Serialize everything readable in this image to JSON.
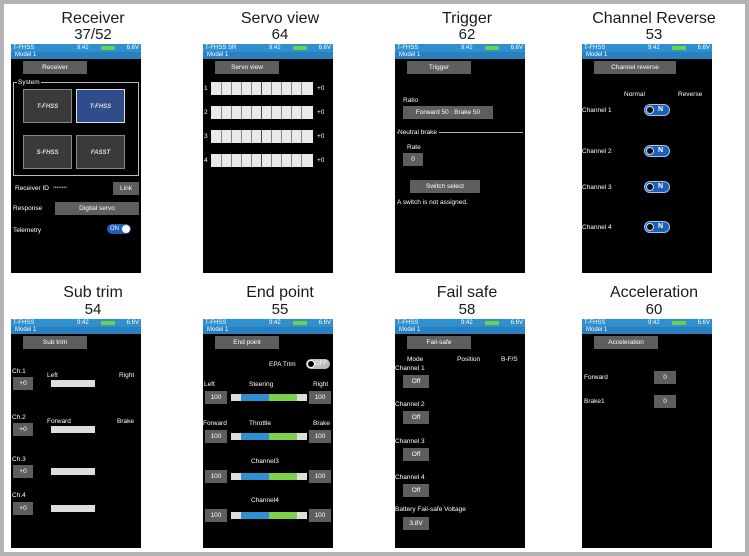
{
  "common": {
    "status_left": "T-FHSS",
    "time": "9:42",
    "volt": "6.6V",
    "model": "Model 1"
  },
  "panels": {
    "receiver": {
      "title": "Receiver",
      "page": "37/52",
      "tab": "Receiver",
      "system": "System",
      "logos": [
        "T-FHSS",
        "T-FHSS",
        "S-FHSS",
        "FASST"
      ],
      "logo_sub": "Telemetry System",
      "rid_label": "Receiver ID",
      "rid_value": "••••••••",
      "link": "Link",
      "resp_label": "Response",
      "resp_value": "Digital servo",
      "tele_label": "Telemetry",
      "tele_value": "ON"
    },
    "servo": {
      "title": "Servo view",
      "page": "64",
      "status_left": "T-FHSS SR",
      "tab": "Servo view",
      "rows": [
        {
          "n": "1",
          "v": "+0"
        },
        {
          "n": "2",
          "v": "+0"
        },
        {
          "n": "3",
          "v": "+0"
        },
        {
          "n": "4",
          "v": "+0"
        }
      ]
    },
    "trigger": {
      "title": "Trigger",
      "page": "62",
      "tab": "Trigger",
      "ratio_label": "Ratio",
      "ratio_value": "Forward 50 : Brake 50",
      "nb_label": "Neutral brake",
      "rate_label": "Rate",
      "rate_value": "0",
      "switch_btn": "Switch select",
      "note": "A switch is not assigned."
    },
    "reverse": {
      "title": "Channel Reverse",
      "page": "53",
      "tab": "Channel reverse",
      "normal": "Normal",
      "reverse": "Reverse",
      "channels": [
        {
          "label": "Channel 1",
          "state": "N"
        },
        {
          "label": "Channel 2",
          "state": "N"
        },
        {
          "label": "Channel 3",
          "state": "N"
        },
        {
          "label": "Channel 4",
          "state": "N"
        }
      ]
    },
    "subtrim": {
      "title": "Sub trim",
      "page": "54",
      "tab": "Sub trim",
      "rows": [
        {
          "ch": "Ch.1",
          "left": "Left",
          "right": "Right",
          "val": "+0"
        },
        {
          "ch": "Ch.2",
          "left": "Forward",
          "right": "Brake",
          "val": "+0"
        },
        {
          "ch": "Ch.3",
          "left": "",
          "right": "",
          "val": "+0"
        },
        {
          "ch": "Ch.4",
          "left": "",
          "right": "",
          "val": "+0"
        }
      ]
    },
    "endpoint": {
      "title": "End point",
      "page": "55",
      "tab": "End point",
      "epa_label": "EPA Trim",
      "epa_value": "OFF",
      "rows": [
        {
          "left_label": "Left",
          "name": "Steering",
          "right_label": "Right",
          "lv": "100",
          "rv": "100"
        },
        {
          "left_label": "Forward",
          "name": "Throttle",
          "right_label": "Brake",
          "lv": "100",
          "rv": "100"
        },
        {
          "left_label": "",
          "name": "Channel3",
          "right_label": "",
          "lv": "100",
          "rv": "100"
        },
        {
          "left_label": "",
          "name": "Channel4",
          "right_label": "",
          "lv": "100",
          "rv": "100"
        }
      ]
    },
    "failsafe": {
      "title": "Fail safe",
      "page": "58",
      "tab": "Fail-safe",
      "volt": "6.6V",
      "mode": "Mode",
      "position": "Position",
      "bfs": "B-F/S",
      "channels": [
        {
          "label": "Channel 1",
          "value": "Off"
        },
        {
          "label": "Channel 2",
          "value": "Off"
        },
        {
          "label": "Channel 3",
          "value": "Off"
        },
        {
          "label": "Channel 4",
          "value": "Off"
        }
      ],
      "batt_label": "Battery Fail-safe Voltage",
      "batt_value": "3.8V"
    },
    "accel": {
      "title": "Acceleration",
      "page": "60",
      "tab": "Acceleration",
      "forward": "Forward",
      "forward_val": "0",
      "brake": "Brake1",
      "brake_val": "0"
    }
  }
}
